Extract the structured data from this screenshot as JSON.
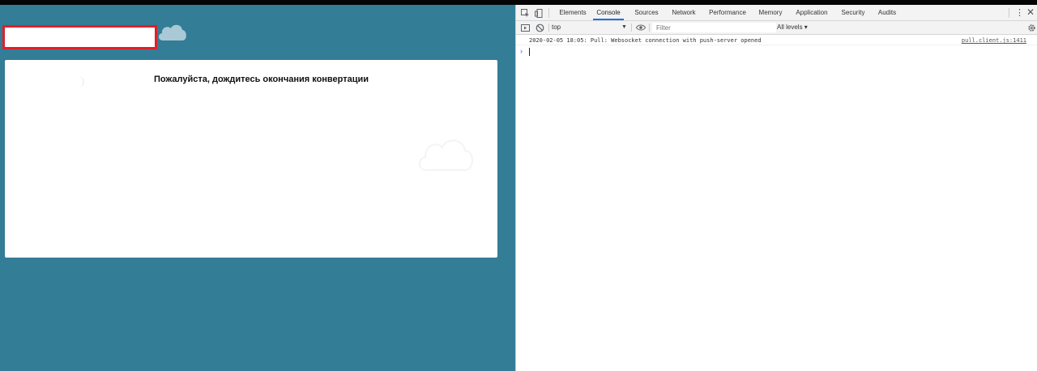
{
  "page": {
    "message": "Пожалуйста, дождитесь окончания конвертации",
    "colors": {
      "background": "#337d96",
      "highlight_border": "#e0202a",
      "card": "#ffffff"
    },
    "icons": {
      "top_cloud": "cloud-icon",
      "card_cloud": "cloud-icon",
      "spinner": "spinner-icon"
    }
  },
  "devtools": {
    "tabs": [
      {
        "label": "Elements"
      },
      {
        "label": "Console",
        "active": true
      },
      {
        "label": "Sources"
      },
      {
        "label": "Network"
      },
      {
        "label": "Performance"
      },
      {
        "label": "Memory"
      },
      {
        "label": "Application"
      },
      {
        "label": "Security"
      },
      {
        "label": "Audits"
      }
    ],
    "toolbar": {
      "context": "top",
      "filter_placeholder": "Filter",
      "levels": "All levels ▾"
    },
    "console": {
      "logs": [
        {
          "text": "2020-02-05 18:05: Pull: Websocket connection with push-server opened",
          "source": "pull.client.js:1411"
        }
      ],
      "prompt": "›"
    },
    "icons": [
      "inspect-element-icon",
      "device-toolbar-icon",
      "sidebar-toggle-icon",
      "clear-console-icon",
      "eye-icon",
      "settings-gear-icon",
      "kebab-menu-icon",
      "close-icon"
    ]
  }
}
